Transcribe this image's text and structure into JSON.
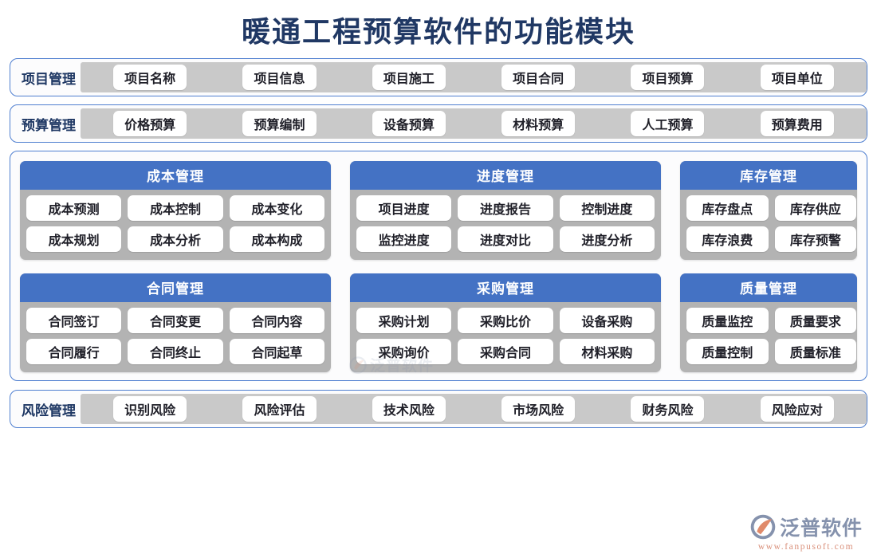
{
  "title": "暖通工程预算软件的功能模块",
  "colors": {
    "title": "#203864",
    "border": "#4f7fd0",
    "card_header": "#4472C4",
    "card_body": "#b3b3b3",
    "strip": "#c9c9c9",
    "chip": "#ffffff",
    "logo_text": "#8592ad",
    "logo_url": "#d98f7a"
  },
  "rows": {
    "project": {
      "label": "项目管理",
      "items": [
        "项目名称",
        "项目信息",
        "项目施工",
        "项目合同",
        "项目预算",
        "项目单位"
      ]
    },
    "budget": {
      "label": "预算管理",
      "items": [
        "价格预算",
        "预算编制",
        "设备预算",
        "材料预算",
        "人工预算",
        "预算费用"
      ]
    },
    "risk": {
      "label": "风险管理",
      "items": [
        "识别风险",
        "风险评估",
        "技术风险",
        "市场风险",
        "财务风险",
        "风险应对"
      ]
    }
  },
  "cards": [
    {
      "title": "成本管理",
      "rows": [
        [
          "成本预测",
          "成本控制",
          "成本变化"
        ],
        [
          "成本规划",
          "成本分析",
          "成本构成"
        ]
      ]
    },
    {
      "title": "进度管理",
      "rows": [
        [
          "项目进度",
          "进度报告",
          "控制进度"
        ],
        [
          "监控进度",
          "进度对比",
          "进度分析"
        ]
      ]
    },
    {
      "title": "库存管理",
      "rows": [
        [
          "库存盘点",
          "库存供应"
        ],
        [
          "库存浪费",
          "库存预警"
        ]
      ]
    },
    {
      "title": "合同管理",
      "rows": [
        [
          "合同签订",
          "合同变更",
          "合同内容"
        ],
        [
          "合同履行",
          "合同终止",
          "合同起草"
        ]
      ]
    },
    {
      "title": "采购管理",
      "rows": [
        [
          "采购计划",
          "采购比价",
          "设备采购"
        ],
        [
          "采购询价",
          "采购合同",
          "材料采购"
        ]
      ]
    },
    {
      "title": "质量管理",
      "rows": [
        [
          "质量监控",
          "质量要求"
        ],
        [
          "质量控制",
          "质量标准"
        ]
      ]
    }
  ],
  "footer": {
    "brand": "泛普软件",
    "url": "www.fanpusoft.com",
    "logo_icon": "fanpu-logo-icon"
  }
}
